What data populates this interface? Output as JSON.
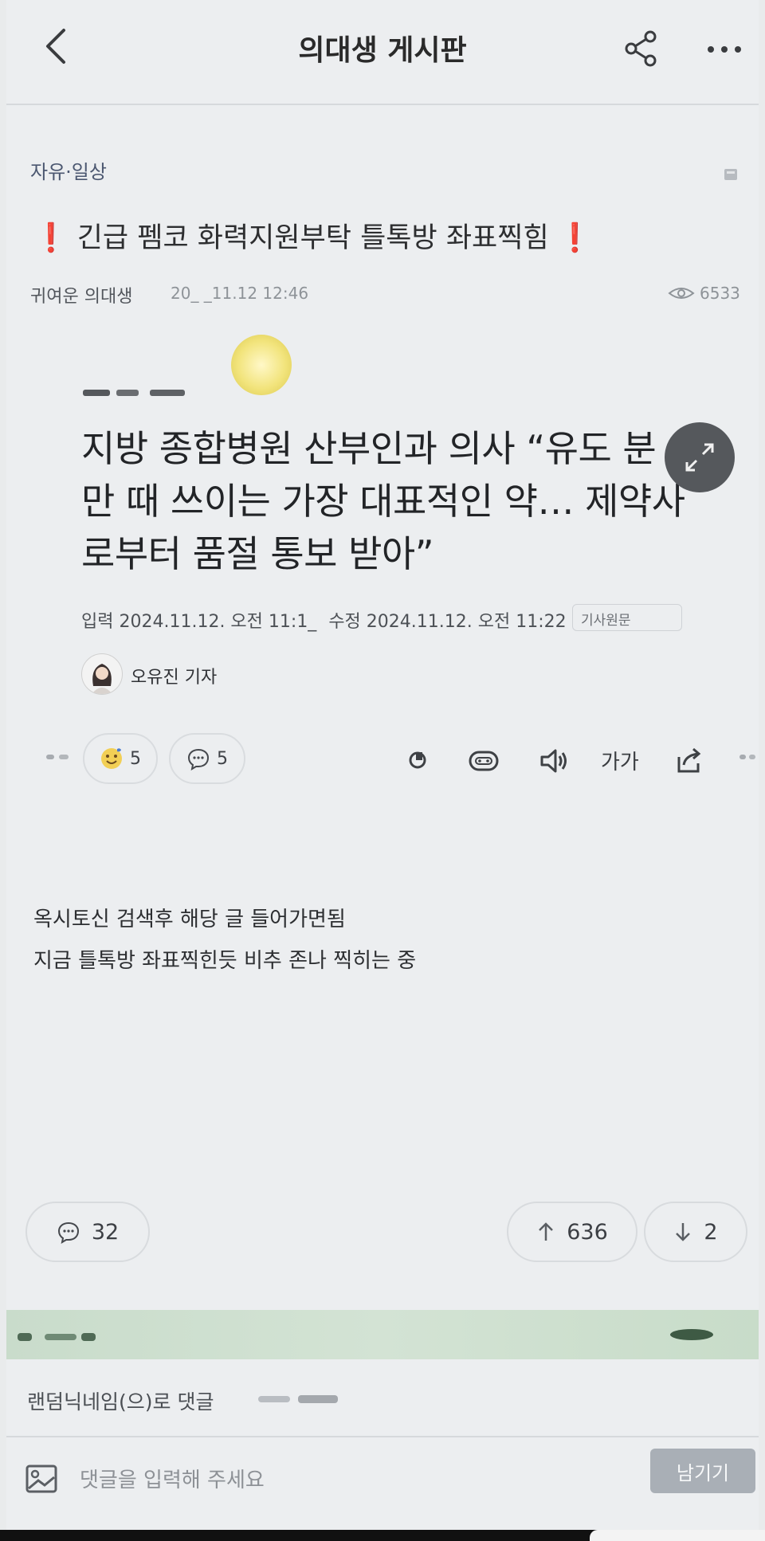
{
  "header": {
    "title": "의대생 게시판",
    "back_icon": "chevron-left-icon",
    "share_icon": "share-icon",
    "more_icon": "more-horizontal-icon"
  },
  "post": {
    "category": "자유·일상",
    "title": "긴급 펨코 화력지원부탁 틀톡방 좌표찍힘",
    "title_mark": "❗",
    "author": "귀여운 의대생",
    "date": "20_ _11.12 12:46",
    "views": "6533"
  },
  "article": {
    "headline_lines": [
      "지방 종합병원 산부인과 의사 “유도 분",
      "만 때 쓰이는 가장 대표적인 약… 제약사",
      "로부터 품절 통보 받아”"
    ],
    "meta": {
      "input_label": "입력",
      "input_date": "2024.11.12. 오전 11:1_",
      "edit_label": "수정",
      "edit_date": "2024.11.12. 오전 11:22",
      "badge": "기사원문"
    },
    "reporter": "오유진 기자",
    "reaction_count": "5",
    "comment_count": "5",
    "font_size_label": "가가"
  },
  "body": {
    "lines": [
      "옥시토신 검색후 해당 글 들어가면됨",
      "지금 틀톡방 좌표찍힌듯 비추 존나 찍히는 중"
    ]
  },
  "stats": {
    "comments": "32",
    "upvotes": "636",
    "downvotes": "2"
  },
  "comment_area": {
    "nickname_text": "랜덤닉네임(으)로 댓글",
    "placeholder": "댓글을 입력해 주세요",
    "submit_label": "남기기"
  },
  "colors": {
    "background": "#eceef0",
    "accent_red": "#d63b3b",
    "submit_bg": "#a9afb6",
    "green_band": "#cfe0d0"
  }
}
